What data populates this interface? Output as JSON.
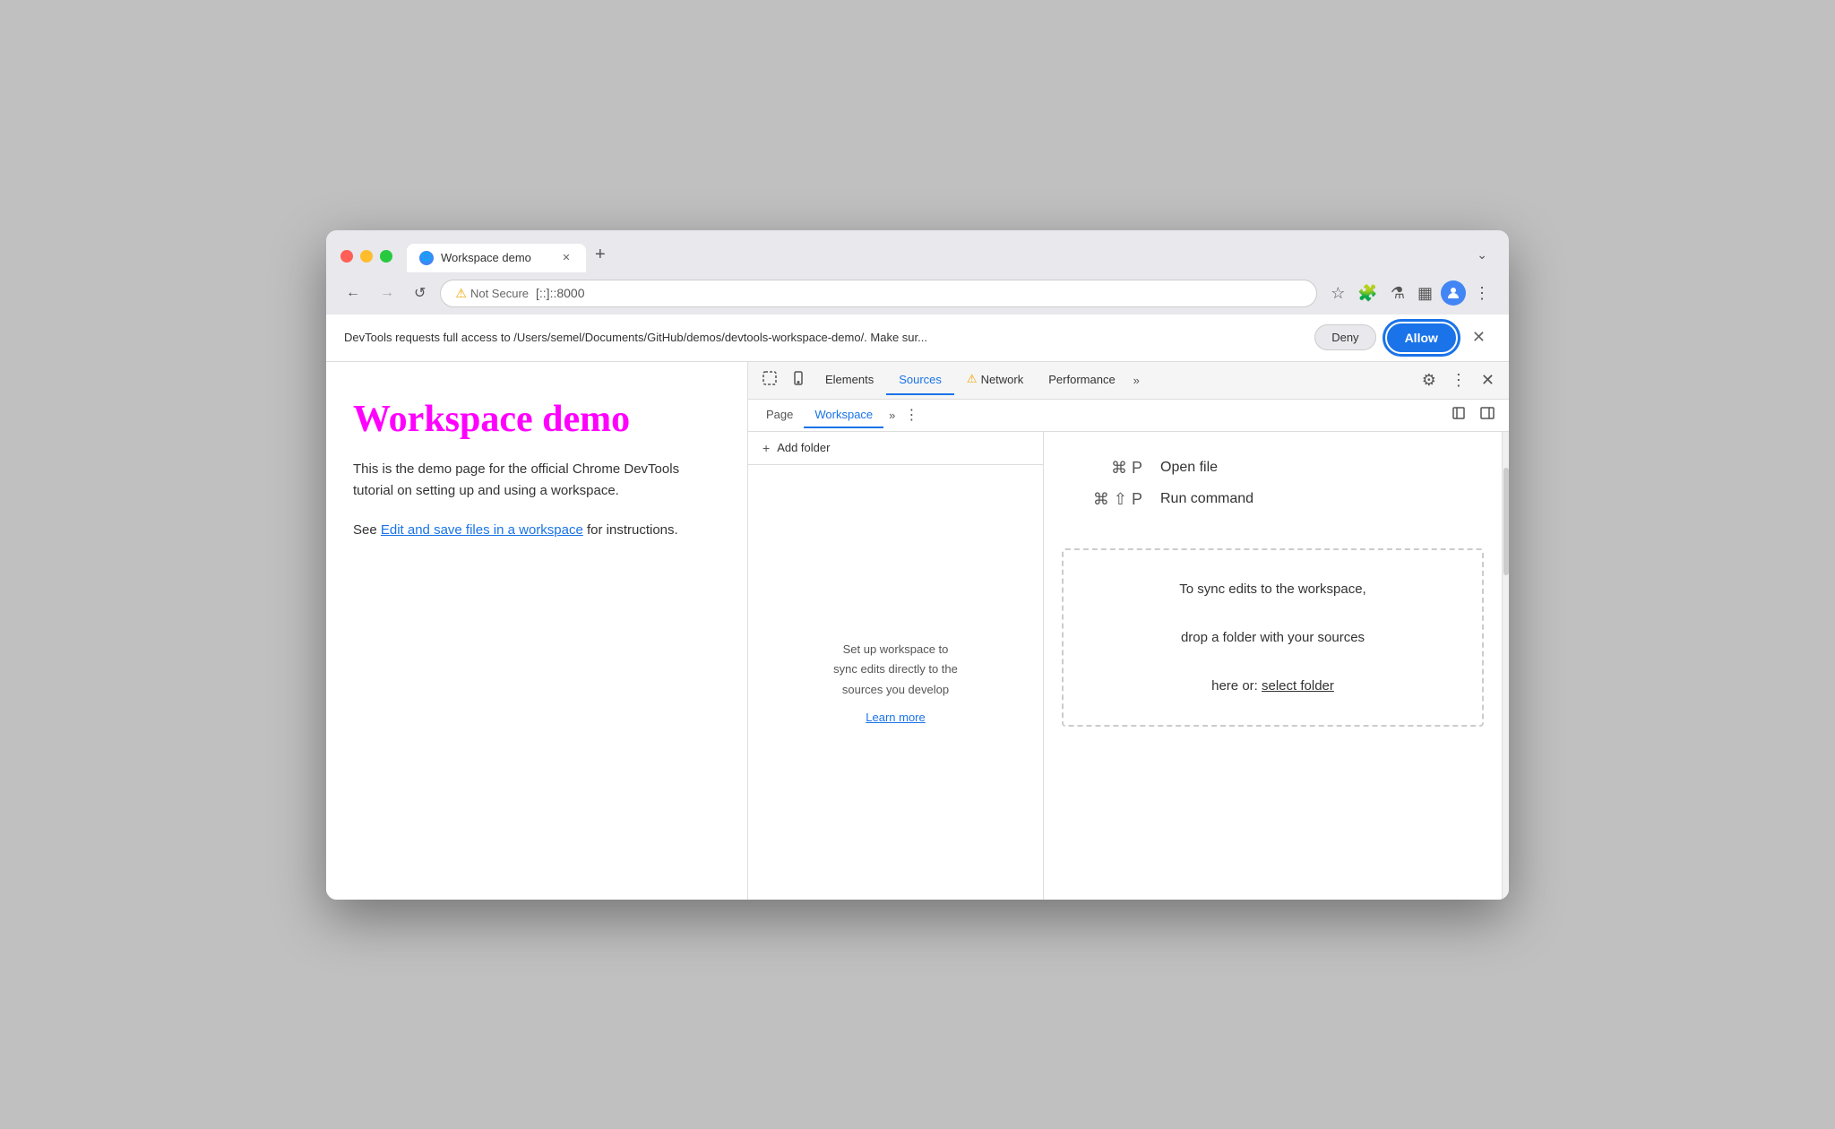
{
  "browser": {
    "traffic_lights": {
      "red": "#ff5f56",
      "yellow": "#ffbd2e",
      "green": "#27c93f"
    },
    "tab": {
      "title": "Workspace demo",
      "favicon_label": "🌐"
    },
    "new_tab_label": "+",
    "tab_overflow_label": "⌄",
    "nav": {
      "back_label": "←",
      "forward_label": "→",
      "reload_label": "↺"
    },
    "address_bar": {
      "security_label": "Not Secure",
      "url": "[::]::8000"
    },
    "toolbar": {
      "bookmark_label": "☆",
      "extensions_label": "🧩",
      "labs_label": "⚗",
      "sidebar_label": "▦",
      "menu_label": "⋮"
    }
  },
  "notification": {
    "text": "DevTools requests full access to /Users/semel/Documents/GitHub/demos/devtools-workspace-demo/. Make sur...",
    "deny_label": "Deny",
    "allow_label": "Allow",
    "close_label": "✕"
  },
  "webpage": {
    "title": "Workspace demo",
    "description": "This is the demo page for the official Chrome DevTools tutorial on setting up and using a workspace.",
    "link_prefix": "See ",
    "link_text": "Edit and save files in a workspace",
    "link_suffix": " for instructions."
  },
  "devtools": {
    "toolbar_tabs": [
      {
        "label": "Elements",
        "active": false
      },
      {
        "label": "Sources",
        "active": true
      },
      {
        "label": "Network",
        "active": false
      },
      {
        "label": "Performance",
        "active": false
      }
    ],
    "toolbar_more_label": "»",
    "settings_label": "⚙",
    "dots_label": "⋮",
    "close_label": "✕",
    "dock_label": "⊟",
    "cursor_icon": "⬚",
    "mobile_icon": "▣",
    "network_warning": "⚠",
    "secondary_tabs": [
      {
        "label": "Page",
        "active": false
      },
      {
        "label": "Workspace",
        "active": true
      }
    ],
    "secondary_more_label": "»",
    "secondary_dots_label": "⋮",
    "secondary_toggle_label": "◫",
    "add_folder": {
      "icon": "+",
      "label": "Add folder"
    },
    "workspace_empty": {
      "line1": "Set up workspace to",
      "line2": "sync edits directly to the",
      "line3": "sources you develop",
      "learn_more_label": "Learn more"
    },
    "editor": {
      "shortcut1_key": "⌘ P",
      "shortcut1_desc": "Open file",
      "shortcut2_key": "⌘ ⇧ P",
      "shortcut2_desc": "Run command",
      "dropzone_line1": "To sync edits to the workspace,",
      "dropzone_line2": "drop a folder with your sources",
      "dropzone_line3_prefix": "here or: ",
      "dropzone_link": "select folder"
    }
  }
}
